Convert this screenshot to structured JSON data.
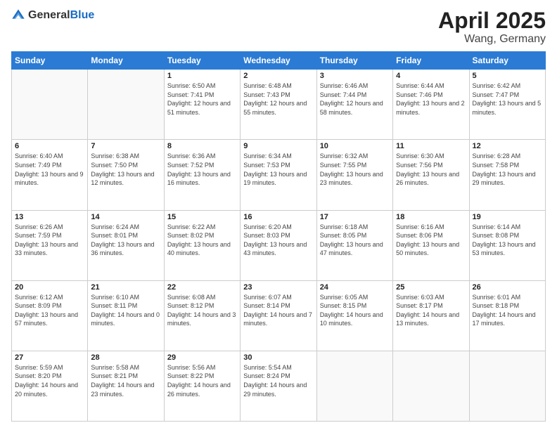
{
  "header": {
    "logo_general": "General",
    "logo_blue": "Blue",
    "month": "April 2025",
    "location": "Wang, Germany"
  },
  "weekdays": [
    "Sunday",
    "Monday",
    "Tuesday",
    "Wednesday",
    "Thursday",
    "Friday",
    "Saturday"
  ],
  "weeks": [
    [
      {
        "day": "",
        "info": ""
      },
      {
        "day": "",
        "info": ""
      },
      {
        "day": "1",
        "info": "Sunrise: 6:50 AM\nSunset: 7:41 PM\nDaylight: 12 hours and 51 minutes."
      },
      {
        "day": "2",
        "info": "Sunrise: 6:48 AM\nSunset: 7:43 PM\nDaylight: 12 hours and 55 minutes."
      },
      {
        "day": "3",
        "info": "Sunrise: 6:46 AM\nSunset: 7:44 PM\nDaylight: 12 hours and 58 minutes."
      },
      {
        "day": "4",
        "info": "Sunrise: 6:44 AM\nSunset: 7:46 PM\nDaylight: 13 hours and 2 minutes."
      },
      {
        "day": "5",
        "info": "Sunrise: 6:42 AM\nSunset: 7:47 PM\nDaylight: 13 hours and 5 minutes."
      }
    ],
    [
      {
        "day": "6",
        "info": "Sunrise: 6:40 AM\nSunset: 7:49 PM\nDaylight: 13 hours and 9 minutes."
      },
      {
        "day": "7",
        "info": "Sunrise: 6:38 AM\nSunset: 7:50 PM\nDaylight: 13 hours and 12 minutes."
      },
      {
        "day": "8",
        "info": "Sunrise: 6:36 AM\nSunset: 7:52 PM\nDaylight: 13 hours and 16 minutes."
      },
      {
        "day": "9",
        "info": "Sunrise: 6:34 AM\nSunset: 7:53 PM\nDaylight: 13 hours and 19 minutes."
      },
      {
        "day": "10",
        "info": "Sunrise: 6:32 AM\nSunset: 7:55 PM\nDaylight: 13 hours and 23 minutes."
      },
      {
        "day": "11",
        "info": "Sunrise: 6:30 AM\nSunset: 7:56 PM\nDaylight: 13 hours and 26 minutes."
      },
      {
        "day": "12",
        "info": "Sunrise: 6:28 AM\nSunset: 7:58 PM\nDaylight: 13 hours and 29 minutes."
      }
    ],
    [
      {
        "day": "13",
        "info": "Sunrise: 6:26 AM\nSunset: 7:59 PM\nDaylight: 13 hours and 33 minutes."
      },
      {
        "day": "14",
        "info": "Sunrise: 6:24 AM\nSunset: 8:01 PM\nDaylight: 13 hours and 36 minutes."
      },
      {
        "day": "15",
        "info": "Sunrise: 6:22 AM\nSunset: 8:02 PM\nDaylight: 13 hours and 40 minutes."
      },
      {
        "day": "16",
        "info": "Sunrise: 6:20 AM\nSunset: 8:03 PM\nDaylight: 13 hours and 43 minutes."
      },
      {
        "day": "17",
        "info": "Sunrise: 6:18 AM\nSunset: 8:05 PM\nDaylight: 13 hours and 47 minutes."
      },
      {
        "day": "18",
        "info": "Sunrise: 6:16 AM\nSunset: 8:06 PM\nDaylight: 13 hours and 50 minutes."
      },
      {
        "day": "19",
        "info": "Sunrise: 6:14 AM\nSunset: 8:08 PM\nDaylight: 13 hours and 53 minutes."
      }
    ],
    [
      {
        "day": "20",
        "info": "Sunrise: 6:12 AM\nSunset: 8:09 PM\nDaylight: 13 hours and 57 minutes."
      },
      {
        "day": "21",
        "info": "Sunrise: 6:10 AM\nSunset: 8:11 PM\nDaylight: 14 hours and 0 minutes."
      },
      {
        "day": "22",
        "info": "Sunrise: 6:08 AM\nSunset: 8:12 PM\nDaylight: 14 hours and 3 minutes."
      },
      {
        "day": "23",
        "info": "Sunrise: 6:07 AM\nSunset: 8:14 PM\nDaylight: 14 hours and 7 minutes."
      },
      {
        "day": "24",
        "info": "Sunrise: 6:05 AM\nSunset: 8:15 PM\nDaylight: 14 hours and 10 minutes."
      },
      {
        "day": "25",
        "info": "Sunrise: 6:03 AM\nSunset: 8:17 PM\nDaylight: 14 hours and 13 minutes."
      },
      {
        "day": "26",
        "info": "Sunrise: 6:01 AM\nSunset: 8:18 PM\nDaylight: 14 hours and 17 minutes."
      }
    ],
    [
      {
        "day": "27",
        "info": "Sunrise: 5:59 AM\nSunset: 8:20 PM\nDaylight: 14 hours and 20 minutes."
      },
      {
        "day": "28",
        "info": "Sunrise: 5:58 AM\nSunset: 8:21 PM\nDaylight: 14 hours and 23 minutes."
      },
      {
        "day": "29",
        "info": "Sunrise: 5:56 AM\nSunset: 8:22 PM\nDaylight: 14 hours and 26 minutes."
      },
      {
        "day": "30",
        "info": "Sunrise: 5:54 AM\nSunset: 8:24 PM\nDaylight: 14 hours and 29 minutes."
      },
      {
        "day": "",
        "info": ""
      },
      {
        "day": "",
        "info": ""
      },
      {
        "day": "",
        "info": ""
      }
    ]
  ]
}
